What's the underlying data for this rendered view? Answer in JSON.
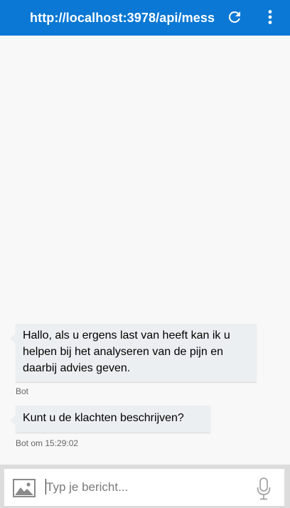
{
  "header": {
    "url": "http://localhost:3978/api/mess",
    "refresh_icon": "refresh-icon",
    "menu_icon": "more-vertical-icon",
    "color": "#0a78d4"
  },
  "messages": [
    {
      "from": "bot",
      "text": "Hallo, als u ergens last van heeft kan ik u helpen bij het analyseren van de pijn en daarbij advies geven.",
      "meta": "Bot"
    },
    {
      "from": "bot",
      "text": "Kunt u de klachten beschrijven?",
      "meta": "Bot om 15:29:02"
    }
  ],
  "composer": {
    "placeholder": "Typ je bericht...",
    "value": "",
    "image_icon": "image-upload-icon",
    "mic_icon": "microphone-icon"
  }
}
